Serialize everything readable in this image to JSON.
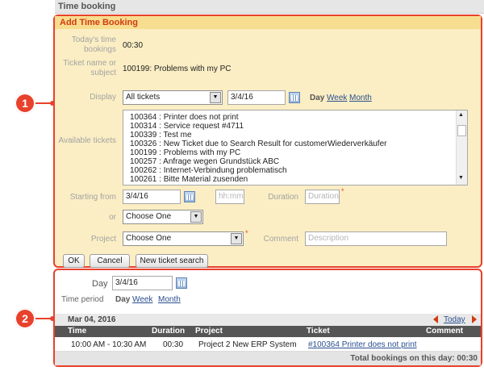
{
  "window_title": "Time booking",
  "form": {
    "title": "Add Time Booking",
    "todays_label": "Today's time bookings",
    "todays_value": "00:30",
    "ticket_label": "Ticket name or subject",
    "ticket_value": "100199: Problems with my PC",
    "display_label": "Display",
    "display_select": "All tickets",
    "display_date": "3/4/16",
    "period_options": [
      "Day",
      "Week",
      "Month"
    ],
    "available_label": "Available tickets",
    "available_tickets": [
      "100364 : Printer does not print",
      "100314 : Service request #4711",
      "100339 : Test me",
      "100326 : New Ticket due to Search Result for customerWiederverkäufer",
      "100199 : Problems with my PC",
      "100257 : Anfrage wegen Grundstück ABC",
      "100262 : Internet-Verbindung problematisch",
      "100261 : Bitte Material zusenden"
    ],
    "starting_label": "Starting from",
    "starting_date": "3/4/16",
    "time_placeholder": "hh:mm",
    "duration_label": "Duration",
    "duration_placeholder": "Duration",
    "or_label": "or",
    "or_select": "Choose One",
    "project_label": "Project",
    "project_select": "Choose One",
    "comment_label": "Comment",
    "comment_placeholder": "Description",
    "required_mark": "*",
    "buttons": {
      "ok": "OK",
      "cancel": "Cancel",
      "new_search": "New ticket search"
    }
  },
  "overview": {
    "day_label": "Day",
    "day_value": "3/4/16",
    "time_period_label": "Time period",
    "period_options": [
      "Day",
      "Week",
      "Month"
    ],
    "date_header": "Mar 04, 2016",
    "today_link": "Today",
    "columns": [
      "Time",
      "Duration",
      "Project",
      "Ticket",
      "Comment"
    ],
    "rows": [
      {
        "time": "10:00 AM - 10:30 AM",
        "duration": "00:30",
        "project": "Project 2 New ERP System",
        "ticket": "#100364 Printer does not print",
        "comment": ""
      }
    ],
    "total": "Total bookings on this day: 00:30"
  },
  "markers": [
    "1",
    "2"
  ],
  "colors": {
    "accent": "#e8412c",
    "panel_bg": "#fbeec4",
    "header_bg": "#f7dd8f",
    "link": "#2a4f8f"
  }
}
